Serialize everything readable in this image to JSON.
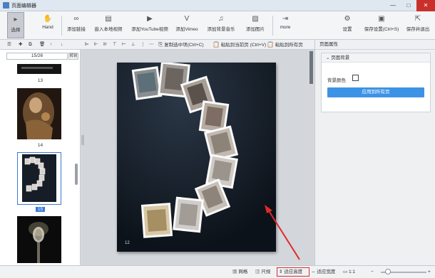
{
  "window": {
    "title": "页面编辑器",
    "controls": [
      "—",
      "□",
      "✕"
    ]
  },
  "ribbon": {
    "buttons": [
      {
        "id": "select",
        "label": "选择",
        "icon": "▸"
      },
      {
        "id": "hand",
        "label": "Hand",
        "icon": "✋"
      },
      {
        "id": "link",
        "label": "添加链接",
        "icon": "∞"
      },
      {
        "id": "local-video",
        "label": "嵌入本地视频",
        "icon": "▤"
      },
      {
        "id": "youtube",
        "label": "添加YouTube视频",
        "icon": "▶"
      },
      {
        "id": "vimeo",
        "label": "添加Vimeo",
        "icon": "V"
      },
      {
        "id": "audio",
        "label": "添加背景音乐",
        "icon": "♫"
      },
      {
        "id": "image",
        "label": "添加图片",
        "icon": "▨"
      },
      {
        "id": "more",
        "label": "more",
        "icon": "⇥"
      },
      {
        "id": "settings",
        "label": "设置",
        "icon": "⚙"
      },
      {
        "id": "save",
        "label": "保存设置(Ctrl+S)",
        "icon": "▣"
      },
      {
        "id": "save-exit",
        "label": "保存并退出",
        "icon": "⇱"
      }
    ]
  },
  "subtoolbar": {
    "copy": "复制选中项(Ctrl+C)",
    "paste_current": "粘贴到当前页 (Ctrl+V)",
    "paste_all": "粘贴到所有页"
  },
  "thumbnails": {
    "page_indicator": "15/26",
    "go_label": "转到",
    "items": [
      {
        "label": "13"
      },
      {
        "label": "14"
      },
      {
        "label": "15",
        "selected": true
      }
    ]
  },
  "canvas": {
    "page_number": "12"
  },
  "right_panel": {
    "header": "页面属性",
    "section_title": "页面背景",
    "bg_color_label": "背景颜色",
    "apply_button": "应用到所有页"
  },
  "statusbar": {
    "grid": "网格",
    "ruler": "尺规",
    "fit_height": "适应高度",
    "fit_width": "适应宽度",
    "zoom": "1:1"
  },
  "colors": {
    "accent": "#3c93e6",
    "highlight": "#e02a2a",
    "page_bg": "#121a24"
  }
}
